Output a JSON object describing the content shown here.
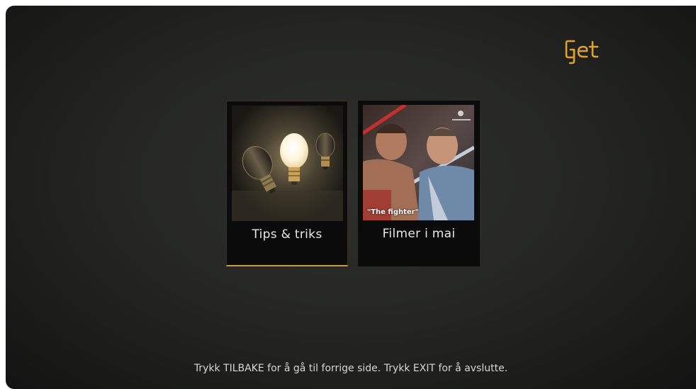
{
  "brand": {
    "logo_text": "Get",
    "accent_color": "#e0a030"
  },
  "menu": {
    "items": [
      {
        "label": "Tips & triks",
        "image": "lightbulbs",
        "selected": true
      },
      {
        "label": "Filmer i mai",
        "image": "boxing-movie-still",
        "caption": "\"The fighter\"",
        "selected": false
      }
    ]
  },
  "footer": {
    "hint": "Trykk TILBAKE for å gå til forrige side. Trykk EXIT for å avslutte."
  }
}
